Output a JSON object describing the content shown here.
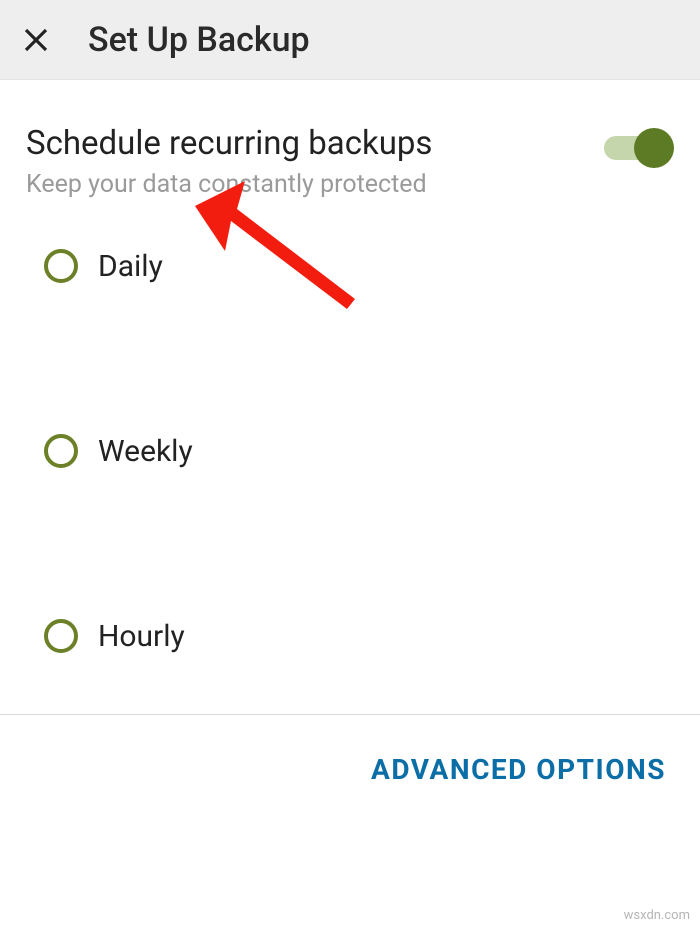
{
  "header": {
    "title": "Set Up Backup"
  },
  "schedule": {
    "title": "Schedule recurring backups",
    "subtitle": "Keep your data constantly protected",
    "enabled": true
  },
  "options": [
    {
      "label": "Daily"
    },
    {
      "label": "Weekly"
    },
    {
      "label": "Hourly"
    }
  ],
  "footer": {
    "advanced": "ADVANCED OPTIONS"
  },
  "watermark": "wsxdn.com"
}
